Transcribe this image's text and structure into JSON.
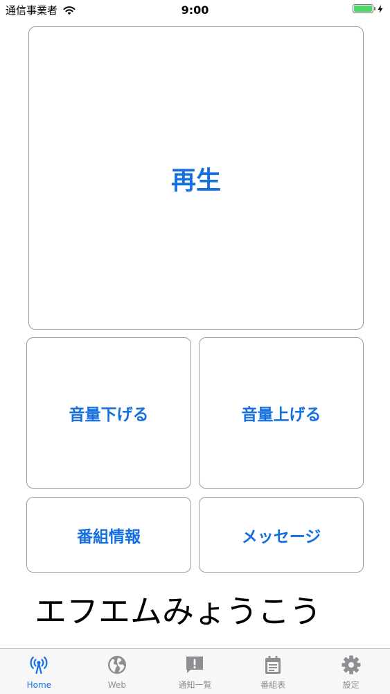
{
  "status_bar": {
    "carrier": "通信事業者",
    "time": "9:00",
    "battery_level": 1.0,
    "battery_color": "#4cd964",
    "icons": [
      "wifi-icon",
      "battery-icon",
      "charging-bolt-icon"
    ]
  },
  "controls": {
    "play_label": "再生",
    "volume_down_label": "音量下げる",
    "volume_up_label": "音量上げる",
    "program_info_label": "番組情報",
    "message_label": "メッセージ"
  },
  "station": {
    "name": "エフエムみょうこう"
  },
  "tab_bar": {
    "active_color": "#166fe0",
    "inactive_color": "#8e8e93",
    "items": [
      {
        "label": "Home",
        "icon": "radio-antenna-icon",
        "active": true
      },
      {
        "label": "Web",
        "icon": "globe-icon",
        "active": false
      },
      {
        "label": "通知一覧",
        "icon": "exclamation-bubble-icon",
        "active": false
      },
      {
        "label": "番組表",
        "icon": "calendar-icon",
        "active": false
      },
      {
        "label": "設定",
        "icon": "gear-icon",
        "active": false
      }
    ]
  }
}
